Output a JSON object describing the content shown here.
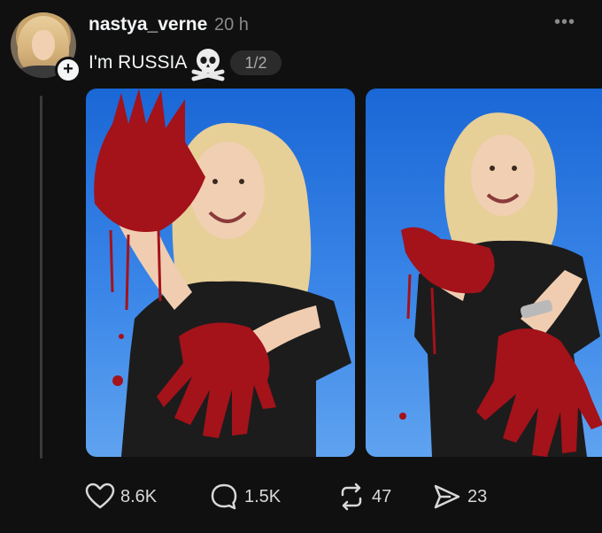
{
  "post": {
    "username": "nastya_verne",
    "time": "20 h",
    "caption": "I'm RUSSIA",
    "caption_icon": "skull-and-crossbones-icon",
    "page_indicator": "1/2",
    "more_icon": "more-options-icon"
  },
  "author": {
    "avatar_icon": "avatar",
    "follow_icon": "plus-icon"
  },
  "media": [
    {
      "name": "photo-1",
      "description_icon": "image"
    },
    {
      "name": "photo-2",
      "description_icon": "image"
    }
  ],
  "actions": {
    "likes": "8.6K",
    "replies": "1.5K",
    "reposts": "47",
    "shares": "23"
  },
  "colors": {
    "background": "#101010",
    "text": "#f3f5f7",
    "muted": "#8a8a8a",
    "sky": "#2f7fe4",
    "blood": "#a4121a"
  }
}
